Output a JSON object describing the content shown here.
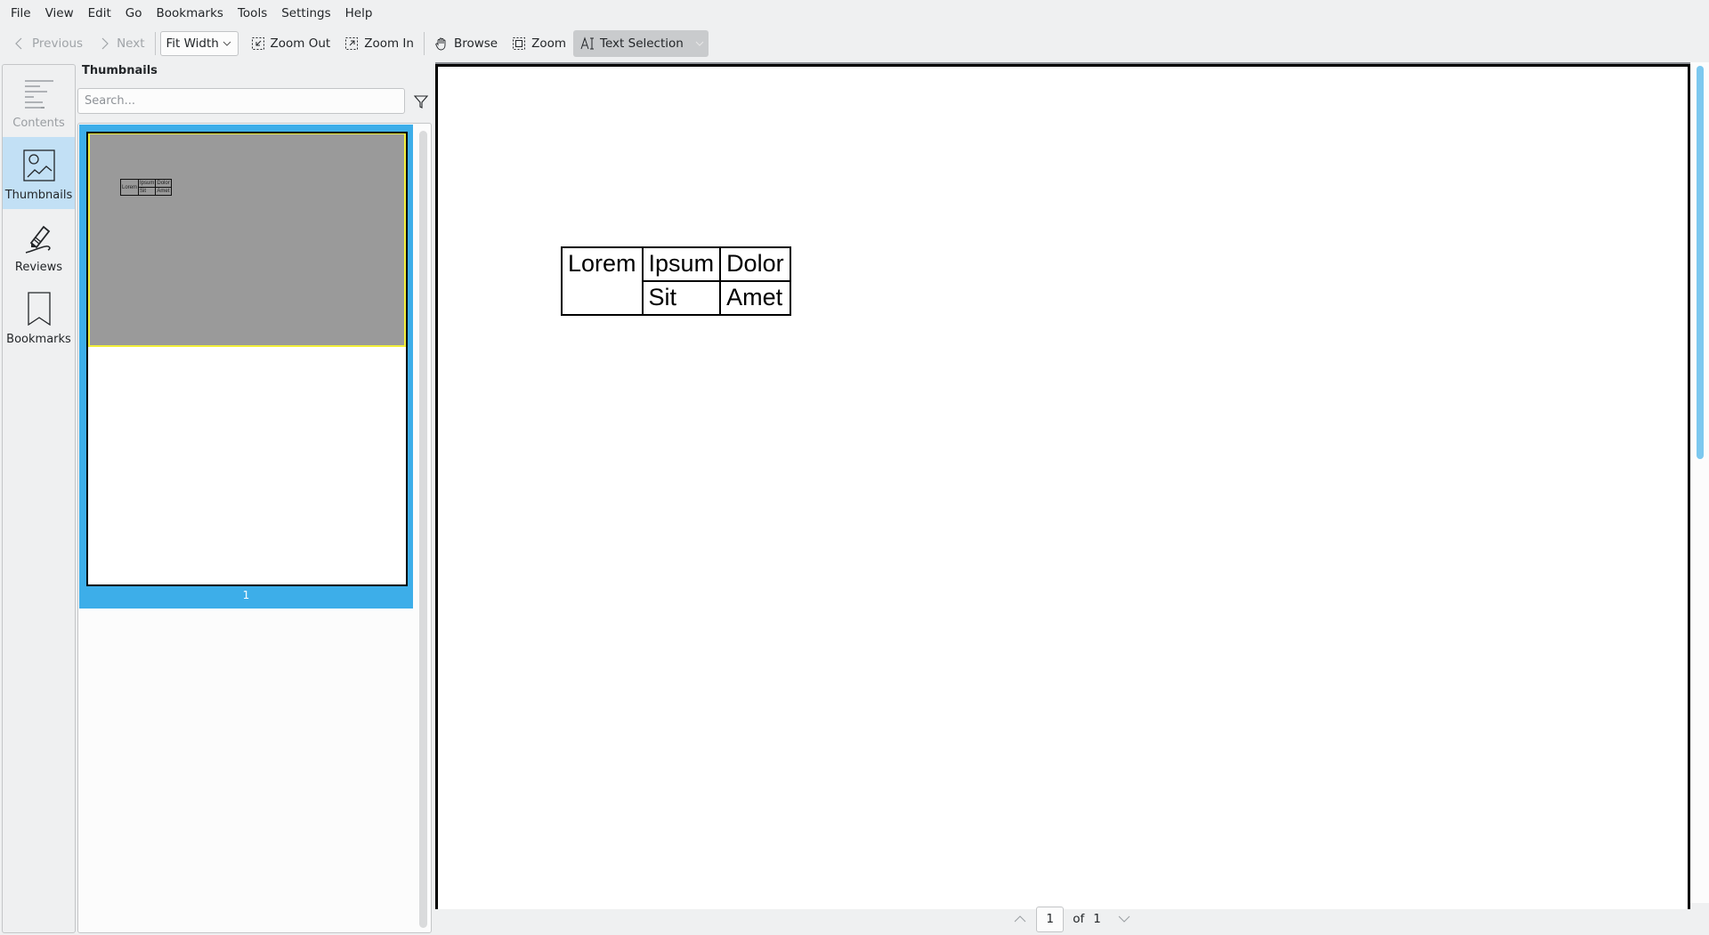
{
  "menubar": {
    "items": [
      "File",
      "View",
      "Edit",
      "Go",
      "Bookmarks",
      "Tools",
      "Settings",
      "Help"
    ]
  },
  "toolbar": {
    "previous": "Previous",
    "next": "Next",
    "zoom_mode": "Fit Width",
    "zoom_out": "Zoom Out",
    "zoom_in": "Zoom In",
    "browse": "Browse",
    "zoom_tool": "Zoom",
    "text_selection": "Text Selection"
  },
  "sidebar": {
    "items": [
      {
        "label": "Contents",
        "icon": "contents-icon",
        "state": "disabled"
      },
      {
        "label": "Thumbnails",
        "icon": "image-icon",
        "state": "selected"
      },
      {
        "label": "Reviews",
        "icon": "pen-icon",
        "state": "normal"
      },
      {
        "label": "Bookmarks",
        "icon": "bookmark-icon",
        "state": "normal"
      }
    ]
  },
  "panel": {
    "title": "Thumbnails",
    "search_placeholder": "Search...",
    "thumbnails": [
      {
        "page": "1"
      }
    ]
  },
  "document": {
    "table": {
      "rows": [
        [
          "Lorem",
          "Ipsum",
          "Dolor"
        ],
        [
          "",
          "Sit",
          "Amet"
        ]
      ]
    }
  },
  "pagination": {
    "current": "1",
    "of_label": "of",
    "total": "1"
  },
  "colors": {
    "accent": "#3daee9",
    "selected_rail": "#c2e0f5",
    "scrollbar": "#7cc8ef",
    "highlight_border": "#f2ef3a"
  }
}
